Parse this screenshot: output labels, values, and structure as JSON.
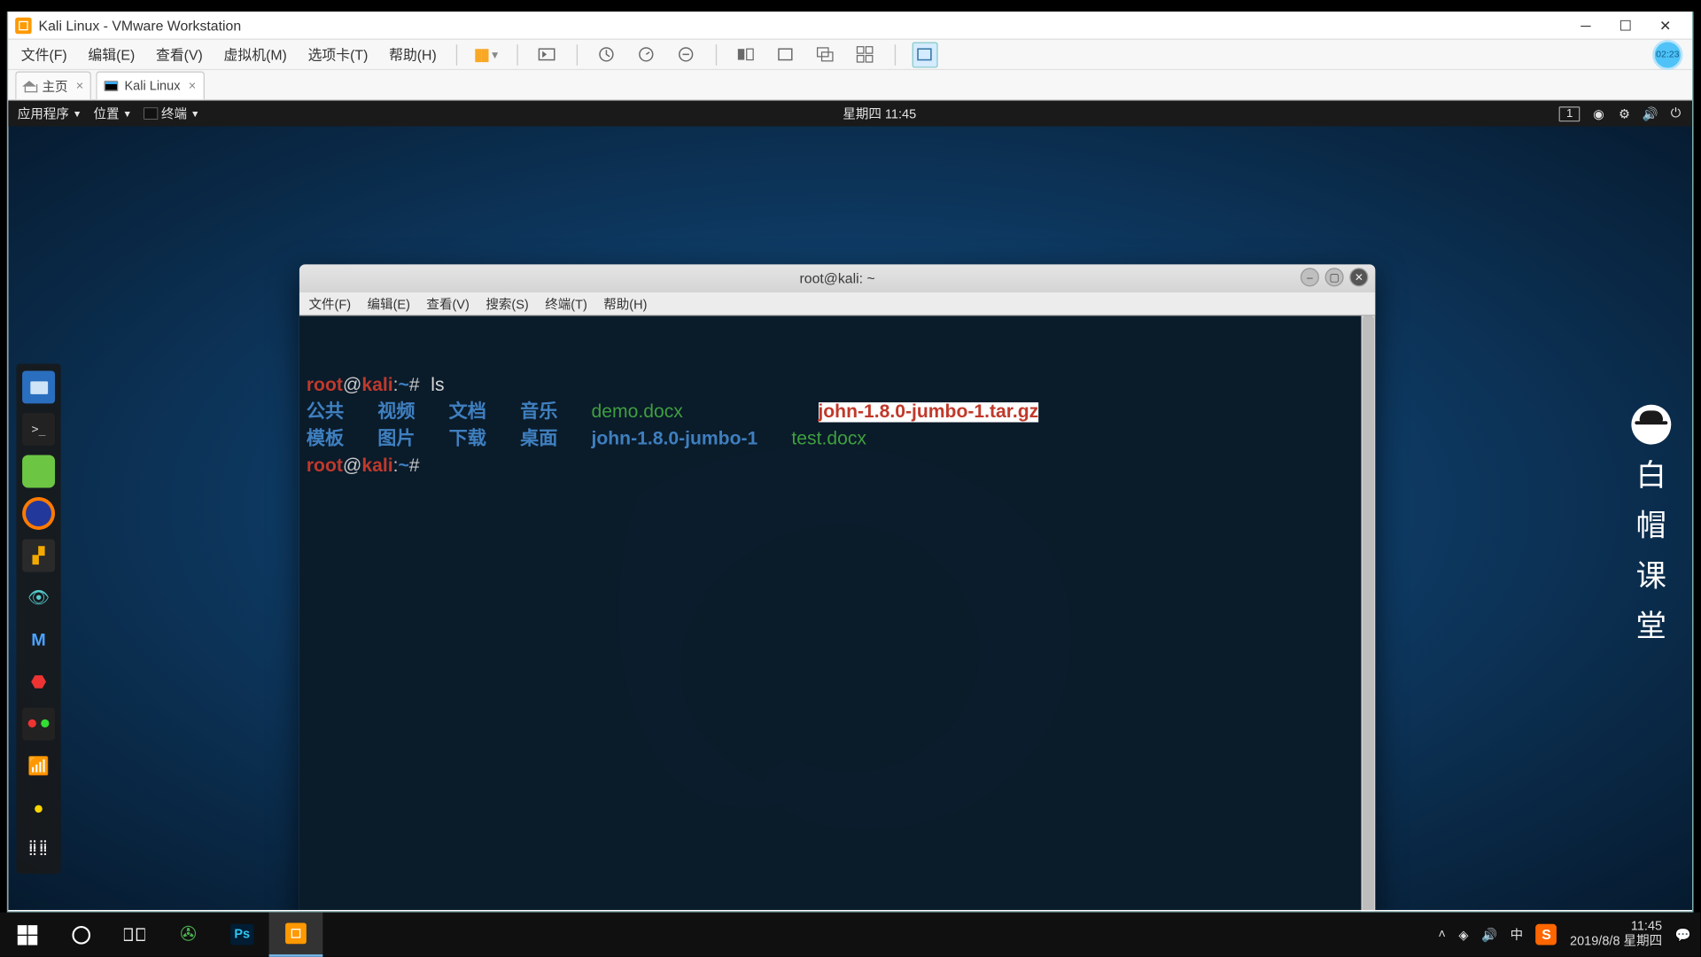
{
  "host": {
    "title": "Kali Linux - VMware Workstation",
    "menus": [
      "文件(F)",
      "编辑(E)",
      "查看(V)",
      "虚拟机(M)",
      "选项卡(T)",
      "帮助(H)"
    ],
    "timer_badge": "02:23",
    "tabs": {
      "home": "主页",
      "vm": "Kali Linux"
    }
  },
  "kali": {
    "topbar": {
      "apps": "应用程序",
      "places": "位置",
      "terminal": "终端",
      "clock": "星期四 11:45",
      "workspace": "1"
    },
    "terminal": {
      "title": "root@kali: ~",
      "menus": [
        "文件(F)",
        "编辑(E)",
        "查看(V)",
        "搜索(S)",
        "终端(T)",
        "帮助(H)"
      ],
      "prompt": {
        "user": "root",
        "host": "kali",
        "path": "~",
        "sep1": "@",
        "sep2": ":",
        "hash": "#"
      },
      "cmd1": "ls",
      "ls": {
        "row1": {
          "c1": "公共",
          "c2": "视频",
          "c3": "文档",
          "c4": "音乐",
          "c5": "demo.docx",
          "c6": "john-1.8.0-jumbo-1.tar.gz"
        },
        "row2": {
          "c1": "模板",
          "c2": "图片",
          "c3": "下载",
          "c4": "桌面",
          "c5": "john-1.8.0-jumbo-1",
          "c6": "test.docx"
        }
      }
    }
  },
  "watermark": {
    "c1": "白",
    "c2": "帽",
    "c3": "课",
    "c4": "堂"
  },
  "wintask": {
    "tray": {
      "ime": "中",
      "time": "11:45",
      "date": "2019/8/8 星期四"
    }
  }
}
